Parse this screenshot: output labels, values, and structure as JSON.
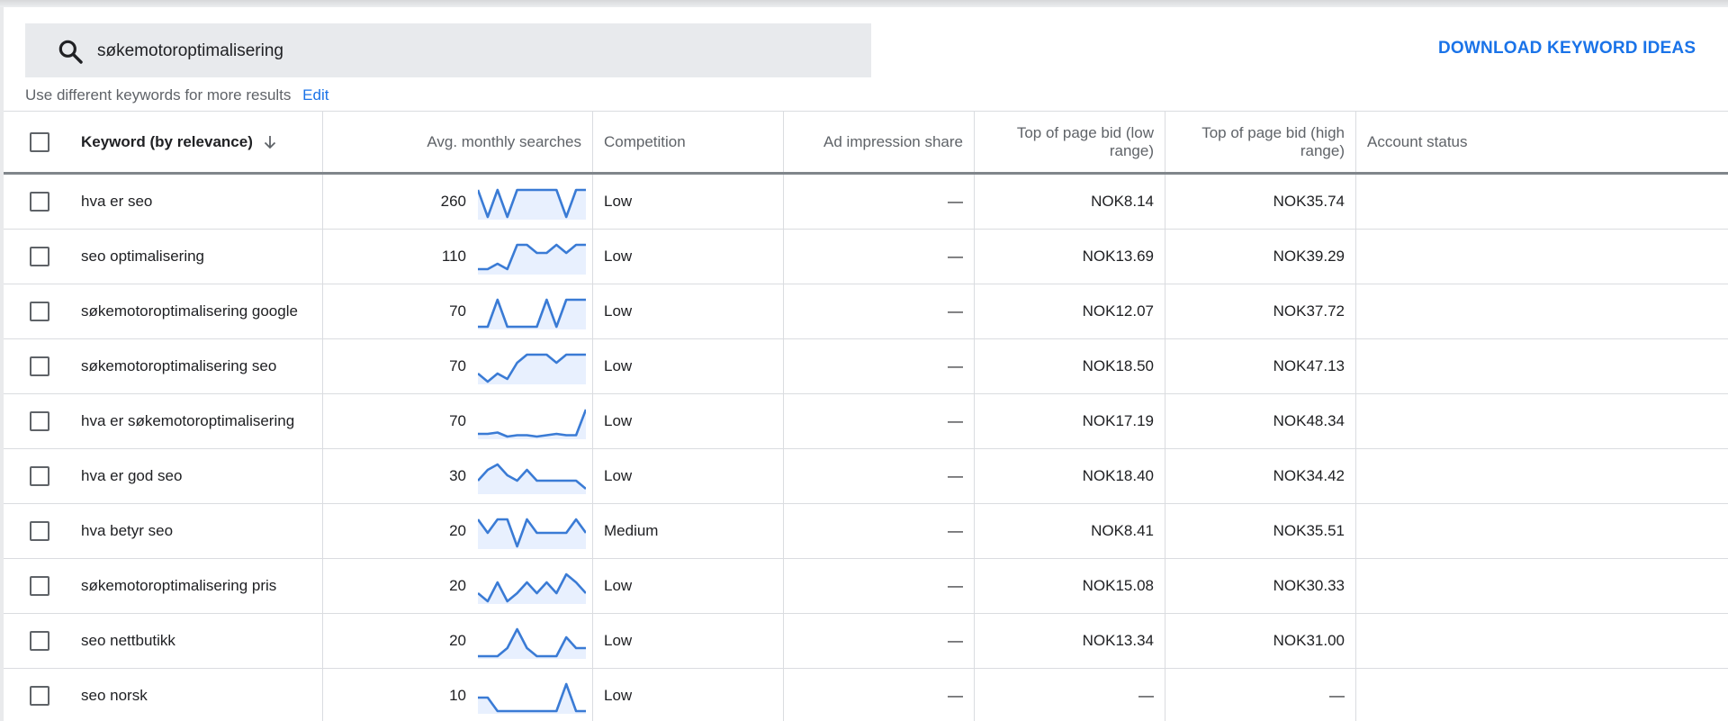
{
  "search": {
    "value": "søkemotoroptimalisering",
    "hint": "Use different keywords for more results",
    "edit_label": "Edit"
  },
  "actions": {
    "download_label": "DOWNLOAD KEYWORD IDEAS"
  },
  "table": {
    "headers": {
      "keyword": "Keyword (by relevance)",
      "avg_searches": "Avg. monthly searches",
      "competition": "Competition",
      "impression_share": "Ad impression share",
      "bid_low": "Top of page bid (low range)",
      "bid_high": "Top of page bid (high range)",
      "account_status": "Account status"
    },
    "rows": [
      {
        "keyword": "hva er seo",
        "avg": "260",
        "competition": "Low",
        "impression": "—",
        "low": "NOK8.14",
        "high": "NOK35.74",
        "status": "",
        "trend": [
          10,
          0,
          10,
          0,
          10,
          10,
          10,
          10,
          10,
          0,
          10,
          10
        ]
      },
      {
        "keyword": "seo optimalisering",
        "avg": "110",
        "competition": "Low",
        "impression": "—",
        "low": "NOK13.69",
        "high": "NOK39.29",
        "status": "",
        "trend": [
          1,
          1,
          3,
          1,
          10,
          10,
          7,
          7,
          10,
          7,
          10,
          10
        ]
      },
      {
        "keyword": "søkemotoroptimalisering google",
        "avg": "70",
        "competition": "Low",
        "impression": "—",
        "low": "NOK12.07",
        "high": "NOK37.72",
        "status": "",
        "trend": [
          0,
          0,
          10,
          0,
          0,
          0,
          0,
          10,
          0,
          10,
          10,
          10
        ]
      },
      {
        "keyword": "søkemotoroptimalisering seo",
        "avg": "70",
        "competition": "Low",
        "impression": "—",
        "low": "NOK18.50",
        "high": "NOK47.13",
        "status": "",
        "trend": [
          3,
          0,
          3,
          1,
          7,
          10,
          10,
          10,
          7,
          10,
          10,
          10
        ]
      },
      {
        "keyword": "hva er søkemotoroptimalisering",
        "avg": "70",
        "competition": "Low",
        "impression": "—",
        "low": "NOK17.19",
        "high": "NOK48.34",
        "status": "",
        "trend": [
          1,
          1,
          1.5,
          0,
          0.5,
          0.5,
          0,
          0.5,
          1,
          0.5,
          0.5,
          10
        ]
      },
      {
        "keyword": "hva er god seo",
        "avg": "30",
        "competition": "Low",
        "impression": "—",
        "low": "NOK18.40",
        "high": "NOK34.42",
        "status": "",
        "trend": [
          4,
          8,
          10,
          6,
          4,
          8,
          4,
          4,
          4,
          4,
          4,
          1
        ]
      },
      {
        "keyword": "hva betyr seo",
        "avg": "20",
        "competition": "Medium",
        "impression": "—",
        "low": "NOK8.41",
        "high": "NOK35.51",
        "status": "",
        "trend": [
          10,
          5,
          10,
          10,
          0,
          10,
          5,
          5,
          5,
          5,
          10,
          5
        ]
      },
      {
        "keyword": "søkemotoroptimalisering pris",
        "avg": "20",
        "competition": "Low",
        "impression": "—",
        "low": "NOK15.08",
        "high": "NOK30.33",
        "status": "",
        "trend": [
          3,
          0,
          7,
          0,
          3,
          7,
          3,
          7,
          3,
          10,
          7,
          3
        ]
      },
      {
        "keyword": "seo nettbutikk",
        "avg": "20",
        "competition": "Low",
        "impression": "—",
        "low": "NOK13.34",
        "high": "NOK31.00",
        "status": "",
        "trend": [
          0,
          0,
          0,
          3,
          10,
          3,
          0,
          0,
          0,
          7,
          3,
          3
        ]
      },
      {
        "keyword": "seo norsk",
        "avg": "10",
        "competition": "Low",
        "impression": "—",
        "low": "—",
        "high": "—",
        "status": "",
        "trend": [
          5,
          5,
          0,
          0,
          0,
          0,
          0,
          0,
          0,
          10,
          0,
          0
        ]
      }
    ]
  },
  "colors": {
    "accent": "#1a73e8",
    "sparkline": "#3a7bd5",
    "sparkline_fill": "#e8f0fe"
  },
  "icons": {
    "search": "search-icon",
    "sort": "arrow-down-icon",
    "checkbox": "checkbox-icon"
  }
}
